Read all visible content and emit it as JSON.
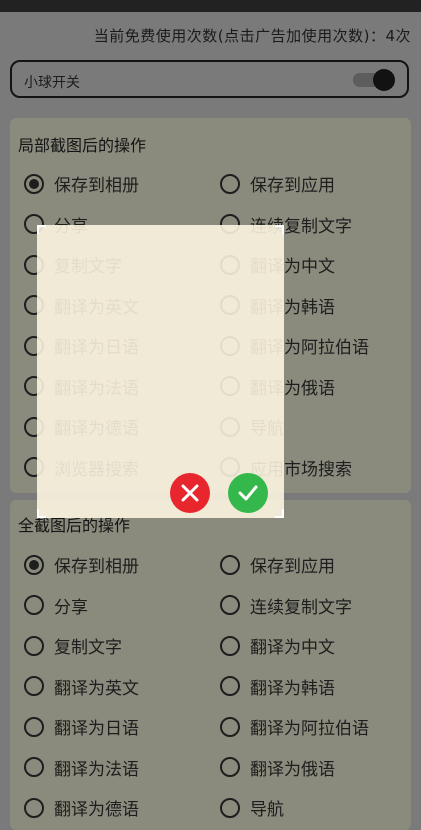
{
  "header": {
    "usage_text": "当前免费使用次数(点击广告加使用次数)：4次"
  },
  "ball_switch": {
    "label": "小球开关",
    "on": true
  },
  "partial_section": {
    "title": "局部截图后的操作",
    "options": [
      {
        "label": "保存到相册",
        "checked": true
      },
      {
        "label": "保存到应用",
        "checked": false
      },
      {
        "label": "分享",
        "checked": false
      },
      {
        "label": "连续复制文字",
        "checked": false
      },
      {
        "label": "复制文字",
        "checked": false
      },
      {
        "label": "翻译为中文",
        "checked": false
      },
      {
        "label": "翻译为英文",
        "checked": false
      },
      {
        "label": "翻译为韩语",
        "checked": false
      },
      {
        "label": "翻译为日语",
        "checked": false
      },
      {
        "label": "翻译为阿拉伯语",
        "checked": false
      },
      {
        "label": "翻译为法语",
        "checked": false
      },
      {
        "label": "翻译为俄语",
        "checked": false
      },
      {
        "label": "翻译为德语",
        "checked": false
      },
      {
        "label": "导航",
        "checked": false
      },
      {
        "label": "浏览器搜索",
        "checked": false
      },
      {
        "label": "应用市场搜索",
        "checked": false
      }
    ]
  },
  "full_section": {
    "title": "全截图后的操作",
    "options": [
      {
        "label": "保存到相册",
        "checked": true
      },
      {
        "label": "保存到应用",
        "checked": false
      },
      {
        "label": "分享",
        "checked": false
      },
      {
        "label": "连续复制文字",
        "checked": false
      },
      {
        "label": "复制文字",
        "checked": false
      },
      {
        "label": "翻译为中文",
        "checked": false
      },
      {
        "label": "翻译为英文",
        "checked": false
      },
      {
        "label": "翻译为韩语",
        "checked": false
      },
      {
        "label": "翻译为日语",
        "checked": false
      },
      {
        "label": "翻译为阿拉伯语",
        "checked": false
      },
      {
        "label": "翻译为法语",
        "checked": false
      },
      {
        "label": "翻译为俄语",
        "checked": false
      },
      {
        "label": "翻译为德语",
        "checked": false
      },
      {
        "label": "导航",
        "checked": false
      }
    ]
  },
  "crop_overlay": {
    "cancel_icon": "close-icon",
    "confirm_icon": "check-icon",
    "cancel_color": "#e8262d",
    "confirm_color": "#34b84c"
  }
}
